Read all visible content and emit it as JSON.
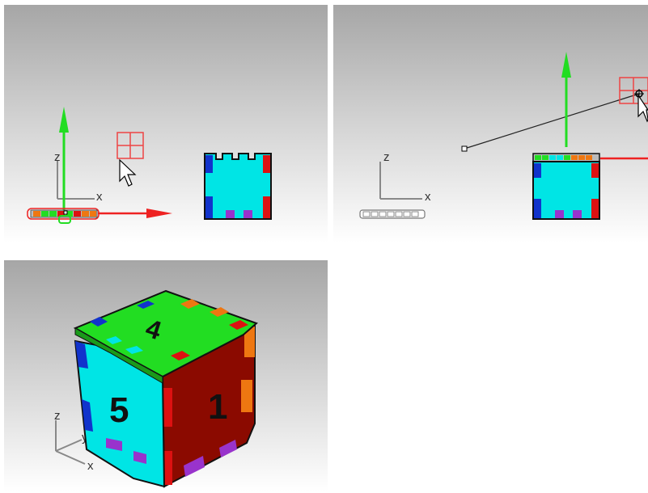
{
  "viewports": {
    "front": {
      "axes": {
        "vertical": "z",
        "horizontal": "x"
      }
    },
    "right": {
      "axes": {
        "vertical": "z",
        "horizontal": "x"
      }
    },
    "perspective": {
      "axes": {
        "vertical": "z",
        "depth": "y",
        "horizontal": "x"
      },
      "face_labels": {
        "top": "4",
        "front": "5",
        "side": "1"
      }
    }
  },
  "colors": {
    "cyan": "#00e5e5",
    "green": "#22dd22",
    "red_side": "#8b0a00",
    "blue": "#1133cc",
    "red": "#dd1111",
    "purple": "#9933cc",
    "orange": "#ee7711",
    "gizmo_green": "#22dd22",
    "gizmo_red": "#ee2222"
  }
}
